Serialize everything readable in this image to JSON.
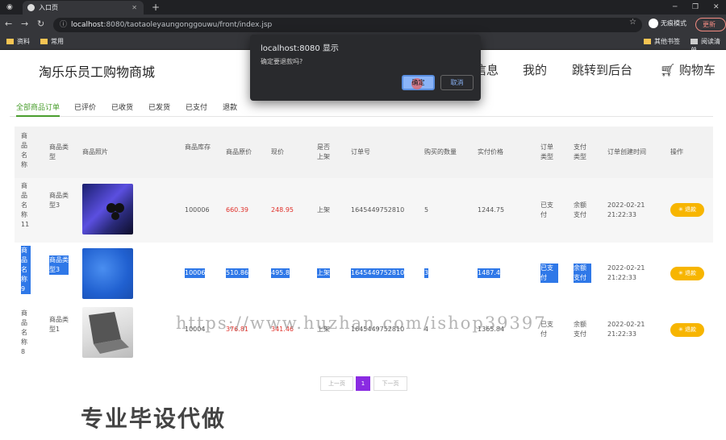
{
  "browser": {
    "tab_title": "入口页",
    "tab_close": "✕",
    "new_tab": "+",
    "url_host": "localhost",
    "url_rest": ":8080/taotaoleyaungonggouwu/front/index.jsp",
    "profile_label": "无痕模式",
    "update_label": "更新",
    "bookmarks": [
      "资料",
      "常用",
      "其他书签",
      "阅读清单"
    ]
  },
  "site": {
    "logo": "淘乐乐员工购物商城",
    "nav": [
      "信息",
      "我的",
      "跳转到后台",
      "购物车"
    ]
  },
  "order_tabs": [
    "全部商品订单",
    "已评价",
    "已收货",
    "已发货",
    "已支付",
    "退款"
  ],
  "table": {
    "headers": [
      "商品名称",
      "商品类型",
      "商品照片",
      "商品库存",
      "商品原价",
      "现价",
      "是否上架",
      "订单号",
      "购买的数量",
      "实付价格",
      "订单类型",
      "支付类型",
      "订单创建时间",
      "操作"
    ],
    "rows": [
      {
        "name": "商品名称11",
        "type": "商品类型3",
        "stock": "100006",
        "orig_price": "660.39",
        "price": "248.95",
        "listed": "上架",
        "order_no": "1645449752810",
        "qty": "5",
        "paid": "1244.75",
        "order_type": "已支付",
        "pay_type": "余额支付",
        "created": "2022-02-21 21:22:33",
        "action": "退款"
      },
      {
        "name": "商品名称9",
        "type": "商品类型3",
        "stock": "10006",
        "orig_price": "510.86",
        "price": "495.8",
        "listed": "上架",
        "order_no": "1645449752810",
        "qty": "3",
        "paid": "1487.4",
        "order_type": "已支付",
        "pay_type": "余额支付",
        "created": "2022-02-21 21:22:33",
        "action": "退款"
      },
      {
        "name": "商品名称8",
        "type": "商品类型1",
        "stock": "10004",
        "orig_price": "376.81",
        "price": "341.46",
        "listed": "上架",
        "order_no": "1645449752810",
        "qty": "4",
        "paid": "1365.84",
        "order_type": "已支付",
        "pay_type": "余额支付",
        "created": "2022-02-21 21:22:33",
        "action": "退款"
      }
    ]
  },
  "pager": {
    "prev": "上一页",
    "current": "1",
    "next": "下一页"
  },
  "watermark": "https://www.huzhan.com/ishop39397",
  "promo": "专业毕设代做",
  "dialog": {
    "title": "localhost:8080 显示",
    "message": "确定要退款吗?",
    "ok": "确定",
    "cancel": "取消"
  },
  "colors": {
    "accent_green": "#4a9e2e",
    "price_red": "#e0312b",
    "refund_yellow": "#f7b500",
    "pager_purple": "#8a2be2",
    "selection_blue": "#2f78e8"
  },
  "icons": [
    "back-arrow-icon",
    "forward-arrow-icon",
    "reload-icon",
    "info-icon",
    "star-icon",
    "cart-icon",
    "refund-icon",
    "folder-icon"
  ]
}
